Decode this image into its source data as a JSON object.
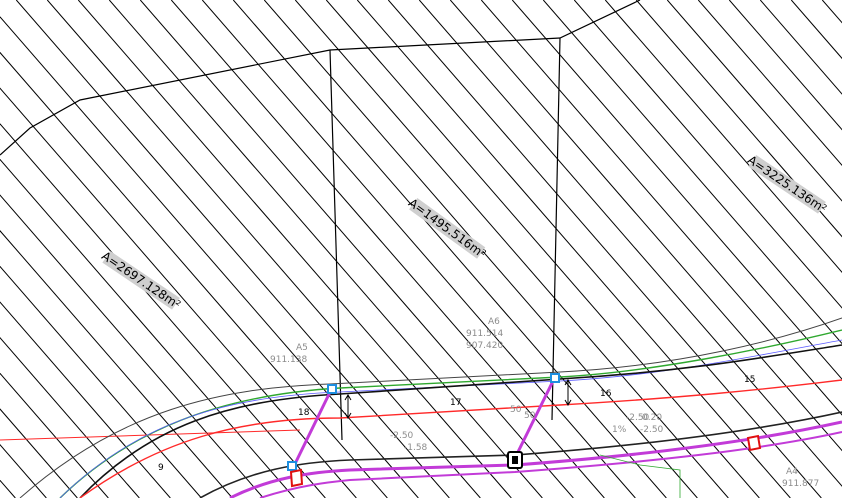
{
  "drawing": {
    "area_labels": [
      {
        "text": "A=2697.128m²"
      },
      {
        "text": "A=1495.516m²"
      },
      {
        "text": "A=3225.136m²"
      }
    ],
    "station_numbers": [
      "18",
      "17",
      "16",
      "15",
      "9"
    ],
    "faint_annotations": [
      "A6",
      "911.514",
      "907.420",
      "A5",
      "911.138",
      "A4",
      "911.877",
      "50",
      "50",
      "0.20",
      "1%",
      "-2.50",
      "-2.50",
      "-1.58",
      "-2.50"
    ],
    "icons": [
      "node-square-icon",
      "manhole-icon",
      "pump-symbol-icon"
    ],
    "colors": {
      "hatch": "#000000",
      "boundary": "#000000",
      "red_line": "#ff2a2a",
      "green_line": "#2fa82f",
      "purple_pipe": "#c23bd8",
      "node_blue": "#1e8fe0"
    }
  }
}
